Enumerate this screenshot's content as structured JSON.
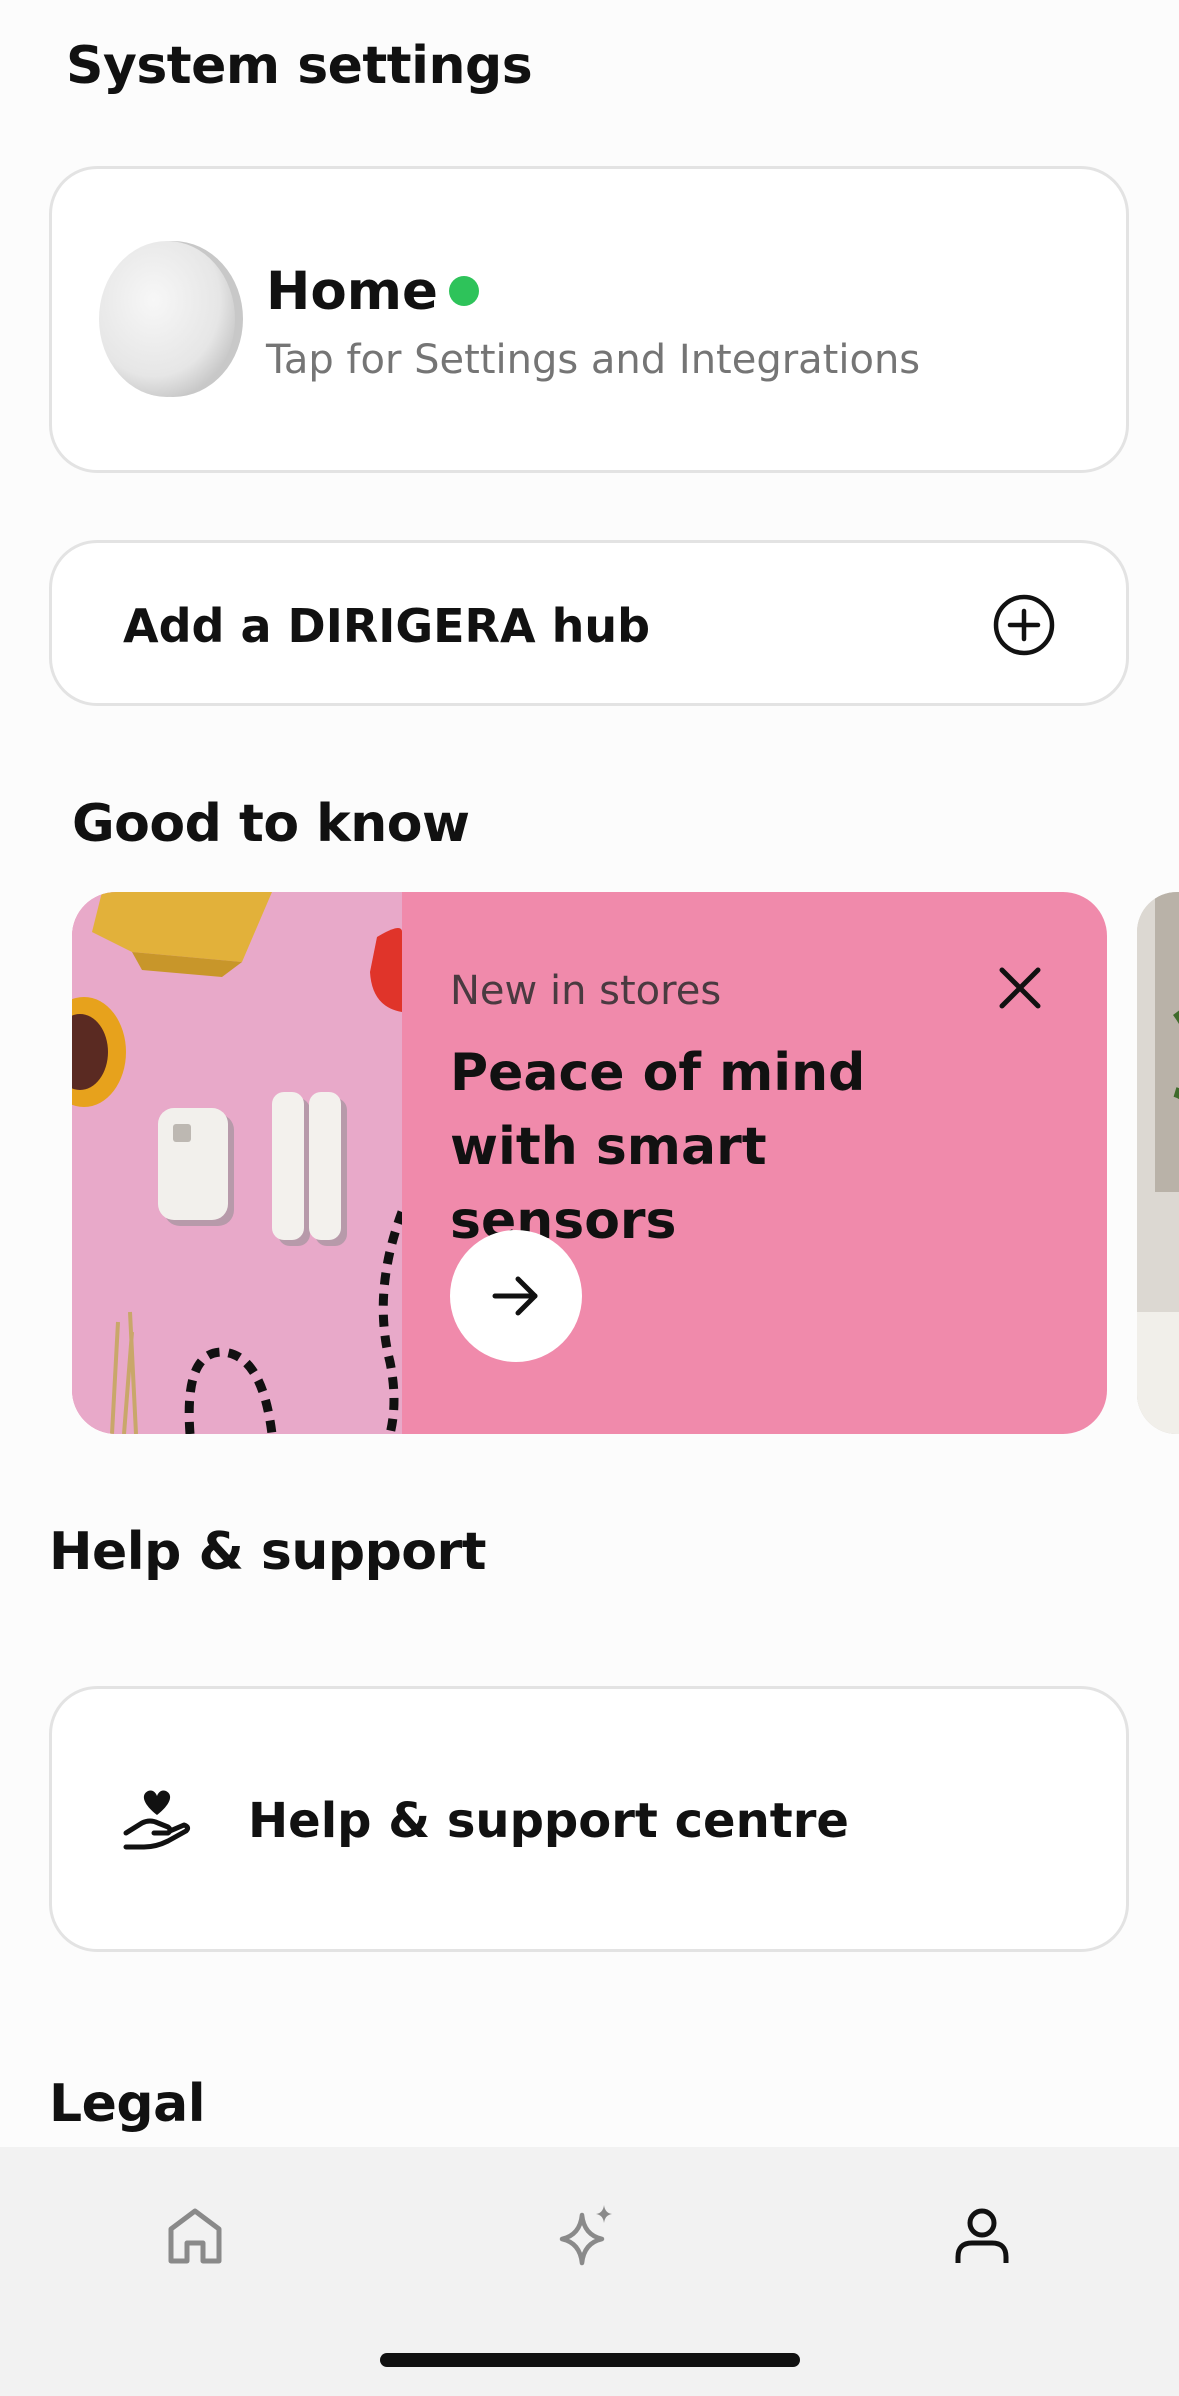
{
  "system_settings": {
    "title": "System settings",
    "hub": {
      "name": "Home",
      "subtitle": "Tap for Settings and Integrations",
      "status_color": "#2ec35a"
    },
    "add_hub_label": "Add a DIRIGERA hub"
  },
  "good_to_know": {
    "title": "Good to know",
    "promo": {
      "kicker": "New in stores",
      "title": "Peace of mind with smart sensors",
      "background": "#f08aab"
    }
  },
  "help": {
    "title": "Help & support",
    "centre_label": "Help & support centre"
  },
  "legal": {
    "title": "Legal"
  },
  "nav": {
    "items": [
      {
        "icon": "home-icon",
        "active": false
      },
      {
        "icon": "sparkle-icon",
        "active": false
      },
      {
        "icon": "profile-icon",
        "active": true
      }
    ]
  }
}
